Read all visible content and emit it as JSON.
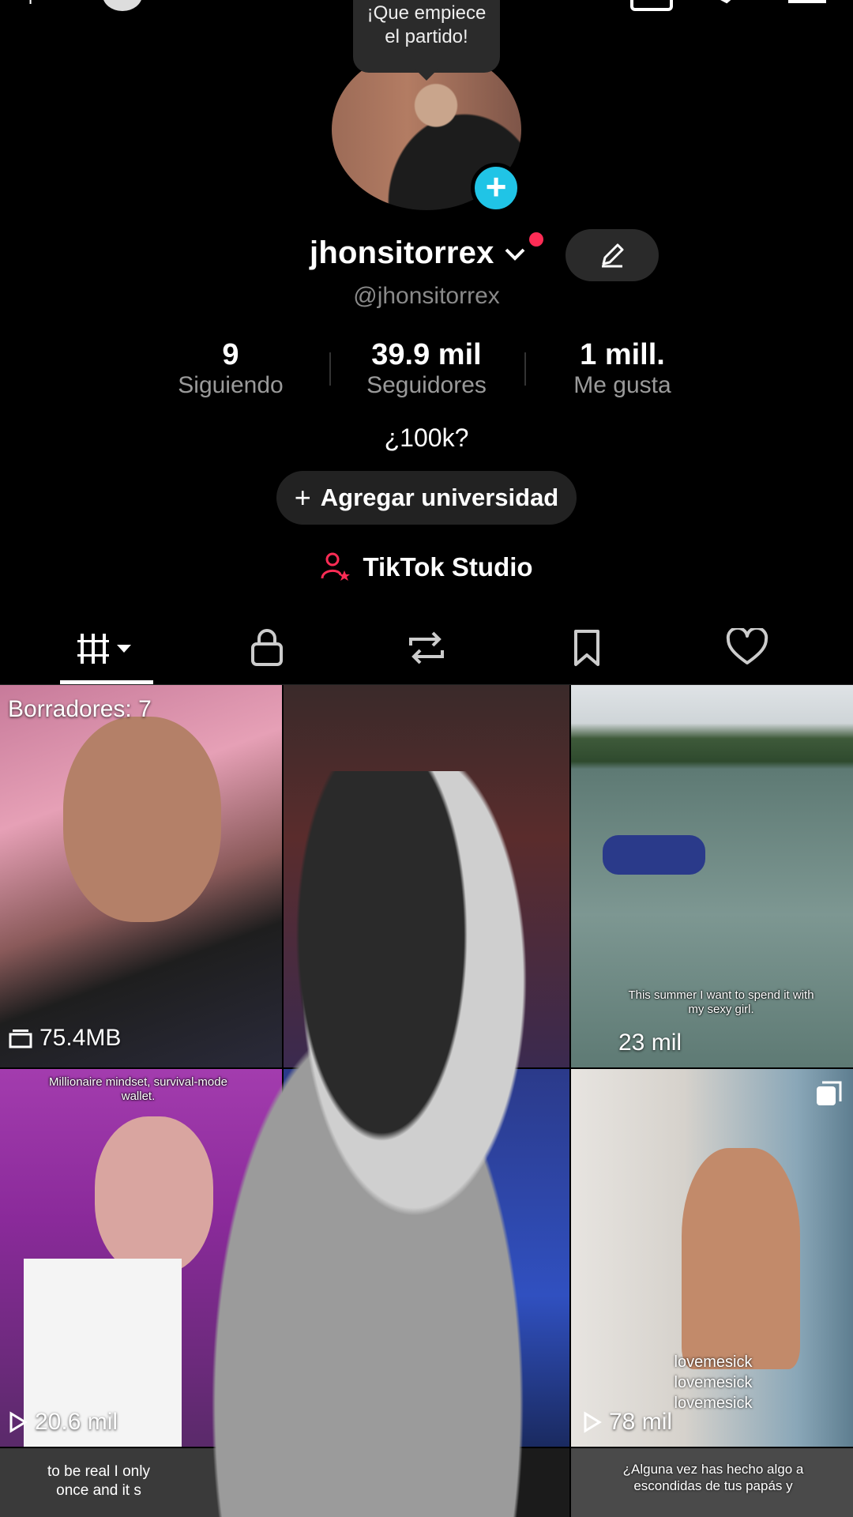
{
  "bubble": {
    "text": "¡Que empiece el partido!"
  },
  "profile": {
    "username": "jhonsitorrex",
    "handle": "@jhonsitorrex",
    "bio": "¿100k?",
    "add_university_label": "Agregar universidad",
    "studio_label": "TikTok Studio"
  },
  "stats": [
    {
      "value": "9",
      "label": "Siguiendo"
    },
    {
      "value": "39.9 mil",
      "label": "Seguidores"
    },
    {
      "value": "1 mill.",
      "label": "Me gusta"
    }
  ],
  "tabs": [
    "videos-icon",
    "lock-icon",
    "repost-icon",
    "bookmark-icon",
    "heart-icon"
  ],
  "grid": {
    "tile1": {
      "label": "Borradores: 7",
      "size": "75.4MB"
    },
    "tile3": {
      "caption": "This summer I want to spend it with my sexy girl.",
      "views": "23 mil"
    },
    "tile4": {
      "caption": "Millionaire mindset, survival-mode wallet.",
      "views": "20.6 mil"
    },
    "tile6": {
      "caption_lines": [
        "lovemesick",
        "lovemesick",
        "lovemesick"
      ],
      "views": "78 mil"
    },
    "tile7": {
      "caption": "to be real I only once and it s"
    },
    "tile9": {
      "caption": "¿Alguna vez has hecho algo a escondidas de tus papás y"
    }
  },
  "colors": {
    "accent_cyan": "#20c4e6",
    "accent_red": "#fe2c55",
    "background": "#000000"
  }
}
